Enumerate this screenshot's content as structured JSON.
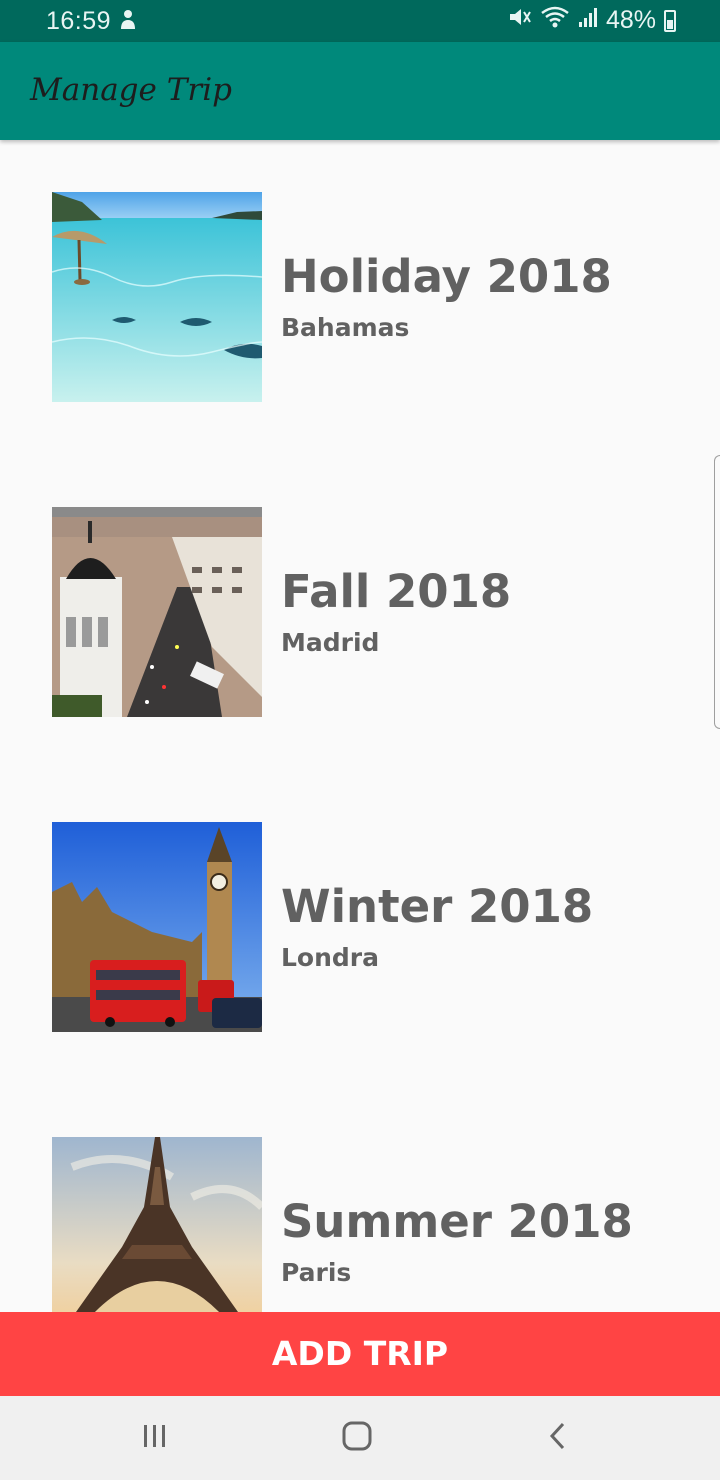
{
  "status_bar": {
    "time": "16:59",
    "battery_percent": "48%",
    "icons": [
      "mute-icon",
      "wifi-icon",
      "signal-icon",
      "battery-icon"
    ]
  },
  "app_bar": {
    "title": "Manage Trip"
  },
  "trips": [
    {
      "title": "Holiday 2018",
      "place": "Bahamas",
      "image": "beach-with-stingrays"
    },
    {
      "title": "Fall 2018",
      "place": "Madrid",
      "image": "city-avenue-aerial"
    },
    {
      "title": "Winter 2018",
      "place": "Londra",
      "image": "big-ben-red-buses"
    },
    {
      "title": "Summer 2018",
      "place": "Paris",
      "image": "eiffel-tower"
    }
  ],
  "add_button": {
    "label": "ADD TRIP"
  },
  "nav_bar": {
    "icons": [
      "recents-icon",
      "home-icon",
      "back-icon"
    ]
  },
  "colors": {
    "app_bar": "#00897b",
    "status_bar": "#00695c",
    "add_button": "#ff4444",
    "text": "#616161"
  }
}
